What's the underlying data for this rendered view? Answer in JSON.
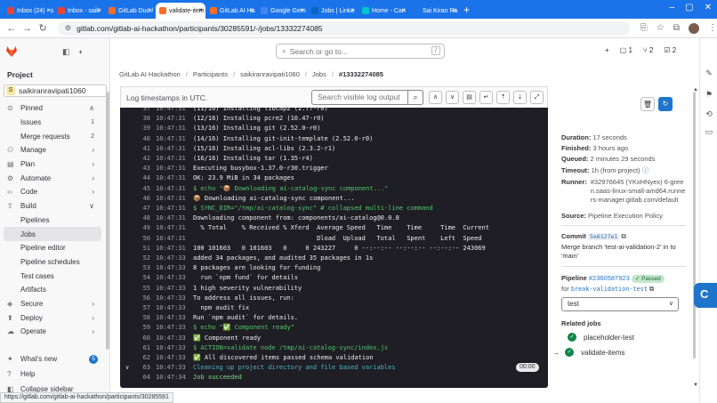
{
  "browser": {
    "tabs": [
      {
        "title": "Inbox (24) - s",
        "color": "#ea4335",
        "active": false
      },
      {
        "title": "Inbox - saik",
        "color": "#ea4335",
        "active": false
      },
      {
        "title": "GitLab Duo /",
        "color": "#fc6d26",
        "active": false
      },
      {
        "title": "validate-item",
        "color": "#fc6d26",
        "active": true
      },
      {
        "title": "GitLab AI Ha",
        "color": "#fc6d26",
        "active": false
      },
      {
        "title": "Google Gem",
        "color": "#4285f4",
        "active": false
      },
      {
        "title": "Jobs | Linke",
        "color": "#0a66c2",
        "active": false
      },
      {
        "title": "Home - Can",
        "color": "#00c4cc",
        "active": false
      },
      {
        "title": "Sai Kiran Ra",
        "color": "#1a73e8",
        "active": false
      }
    ],
    "url": "gitlab.com/gitlab-ai-hackathon/participants/30285591/-/jobs/13332274085",
    "status_url": "https://gitlab.com/gitlab-ai-hackathon/participants/30285591"
  },
  "sidebar": {
    "heading": "Project",
    "project_name": "saikiranravipati1060",
    "project_initial": "S",
    "items": [
      {
        "label": "Pinned",
        "icon": "pin-icon",
        "glyph": "⊙",
        "type": "section",
        "chevron": "∧"
      },
      {
        "label": "Issues",
        "type": "sub",
        "count": "1"
      },
      {
        "label": "Merge requests",
        "type": "sub",
        "count": "2"
      },
      {
        "label": "Manage",
        "icon": "users-icon",
        "glyph": "⚇",
        "type": "section",
        "chevron": "›"
      },
      {
        "label": "Plan",
        "icon": "plan-icon",
        "glyph": "▤",
        "type": "section",
        "chevron": "›"
      },
      {
        "label": "Automate",
        "icon": "automate-icon",
        "glyph": "⚙",
        "type": "section",
        "chevron": "›"
      },
      {
        "label": "Code",
        "icon": "code-icon",
        "glyph": "‹›",
        "type": "section",
        "chevron": "›"
      },
      {
        "label": "Build",
        "icon": "rocket-icon",
        "glyph": "⇧",
        "type": "section",
        "chevron": "∨"
      },
      {
        "label": "Pipelines",
        "type": "sub"
      },
      {
        "label": "Jobs",
        "type": "sub",
        "active": true
      },
      {
        "label": "Pipeline editor",
        "type": "sub"
      },
      {
        "label": "Pipeline schedules",
        "type": "sub"
      },
      {
        "label": "Test cases",
        "type": "sub"
      },
      {
        "label": "Artifacts",
        "type": "sub"
      },
      {
        "label": "Secure",
        "icon": "shield-icon",
        "glyph": "◈",
        "type": "section",
        "chevron": "›"
      },
      {
        "label": "Deploy",
        "icon": "deploy-icon",
        "glyph": "⬆",
        "type": "section",
        "chevron": "›"
      },
      {
        "label": "Operate",
        "icon": "operate-icon",
        "glyph": "☁",
        "type": "section",
        "chevron": "›"
      }
    ],
    "bottom": [
      {
        "label": "What's new",
        "glyph": "✦",
        "badge": "5"
      },
      {
        "label": "Help",
        "glyph": "?"
      },
      {
        "label": "Collapse sidebar",
        "glyph": "◧"
      }
    ],
    "top_counts": {
      "issues": "1",
      "mrs": "2",
      "todos": "2"
    }
  },
  "topbar": {
    "search_placeholder": "Search or go to...",
    "search_kbd": "/",
    "icons": [
      {
        "name": "new-icon",
        "text": "+"
      },
      {
        "name": "issues-count",
        "text": "▢ 1"
      },
      {
        "name": "mr-count",
        "text": "⑂ 2"
      },
      {
        "name": "todo-count",
        "text": "☑ 2"
      }
    ]
  },
  "breadcrumb": [
    "GitLab AI Hackathon",
    "Participants",
    "saikiranravipati1060",
    "Jobs",
    "#13332274085"
  ],
  "log": {
    "timestamps_label": "Log timestamps in UTC.",
    "search_placeholder": "Search visible log output",
    "lines": [
      {
        "n": "37",
        "t": "10:47:31",
        "text": "(11/16) Installing libcap2 (2.77-r0)",
        "c": ""
      },
      {
        "n": "38",
        "t": "10:47:31",
        "text": "(12/16) Installing pcre2 (10.47-r0)",
        "c": ""
      },
      {
        "n": "39",
        "t": "10:47:31",
        "text": "(13/16) Installing git (2.52.0-r0)",
        "c": ""
      },
      {
        "n": "40",
        "t": "10:47:31",
        "text": "(14/16) Installing git-init-template (2.52.0-r0)",
        "c": ""
      },
      {
        "n": "41",
        "t": "10:47:31",
        "text": "(15/16) Installing acl-libs (2.3.2-r1)",
        "c": ""
      },
      {
        "n": "42",
        "t": "10:47:31",
        "text": "(16/16) Installing tar (1.35-r4)",
        "c": ""
      },
      {
        "n": "43",
        "t": "10:47:31",
        "text": "Executing busybox-1.37.0-r30.trigger",
        "c": ""
      },
      {
        "n": "44",
        "t": "10:47:31",
        "text": "OK: 23.9 MiB in 34 packages",
        "c": ""
      },
      {
        "n": "45",
        "t": "10:47:31",
        "text": "$ echo \"📦 Downloading ai-catalog-sync component...\"",
        "c": "c-green"
      },
      {
        "n": "46",
        "t": "10:47:31",
        "text": "📦 Downloading ai-catalog-sync component...",
        "c": ""
      },
      {
        "n": "47",
        "t": "10:47:31",
        "text": "$ SYNC_DIR=\"/tmp/ai-catalog-sync\" # collapsed multi-line command",
        "c": "c-green"
      },
      {
        "n": "48",
        "t": "10:47:31",
        "text": "Downloading component from: components/ai-catalog@0.0.8",
        "c": ""
      },
      {
        "n": "49",
        "t": "10:47:31",
        "text": "  % Total    % Received % Xferd  Average Speed   Time    Time     Time  Current",
        "c": ""
      },
      {
        "n": "50",
        "t": "10:47:31",
        "text": "                                 Dload  Upload   Total   Spent    Left  Speed",
        "c": ""
      },
      {
        "n": "51",
        "t": "10:47:31",
        "text": "100 101603   0 101603   0     0 243227     0 --:--:-- --:--:-- --:--:-- 243069",
        "c": ""
      },
      {
        "n": "52",
        "t": "10:47:33",
        "text": "added 34 packages, and audited 35 packages in 1s",
        "c": ""
      },
      {
        "n": "53",
        "t": "10:47:33",
        "text": "8 packages are looking for funding",
        "c": ""
      },
      {
        "n": "54",
        "t": "10:47:33",
        "text": "  run `npm fund` for details",
        "c": ""
      },
      {
        "n": "55",
        "t": "10:47:33",
        "text": "1 high severity vulnerability",
        "c": ""
      },
      {
        "n": "56",
        "t": "10:47:33",
        "text": "To address all issues, run:",
        "c": ""
      },
      {
        "n": "57",
        "t": "10:47:33",
        "text": "  npm audit fix",
        "c": ""
      },
      {
        "n": "58",
        "t": "10:47:33",
        "text": "Run `npm audit` for details.",
        "c": ""
      },
      {
        "n": "59",
        "t": "10:47:33",
        "text": "$ echo \"✅ Component ready\"",
        "c": "c-green"
      },
      {
        "n": "60",
        "t": "10:47:33",
        "text": "✅ Component ready",
        "c": ""
      },
      {
        "n": "61",
        "t": "10:47:33",
        "text": "$ ACTION=validate node /tmp/ai-catalog-sync/index.js",
        "c": "c-green"
      },
      {
        "n": "62",
        "t": "10:47:33",
        "text": "✅ All discovered items passed schema validation",
        "c": ""
      },
      {
        "n": "63",
        "t": "10:47:33",
        "text": "Cleaning up project directory and file based variables",
        "c": "c-cyan",
        "collapse": true
      },
      {
        "n": "64",
        "t": "10:47:34",
        "text": "Job succeeded",
        "c": "c-ygreen"
      }
    ],
    "duration_badge": "00:00"
  },
  "details": {
    "duration_label": "Duration:",
    "duration": "17 seconds",
    "finished_label": "Finished:",
    "finished": "3 hours ago",
    "queued_label": "Queued:",
    "queued": "2 minutes 29 seconds",
    "timeout_label": "Timeout:",
    "timeout": "1h (from project)",
    "runner_label": "Runner:",
    "runner": "#32976645 (YKxHNyex) 6-green.saas-linux-small-amd64.runners-manager.gitlab.com/default",
    "source_label": "Source:",
    "source": "Pipeline Execution Policy",
    "commit_label": "Commit",
    "commit_sha": "5e6127e1",
    "commit_msg": "Merge branch 'test-ai-validation-2' in to 'main'",
    "pipeline_label": "Pipeline",
    "pipeline_id": "#2360587923",
    "pipeline_status": "Passed",
    "for_label": "for",
    "branch": "break-validation-test",
    "stage_select": "test",
    "related_label": "Related jobs",
    "related_jobs": [
      "placeholder-test",
      "validate-items"
    ]
  }
}
